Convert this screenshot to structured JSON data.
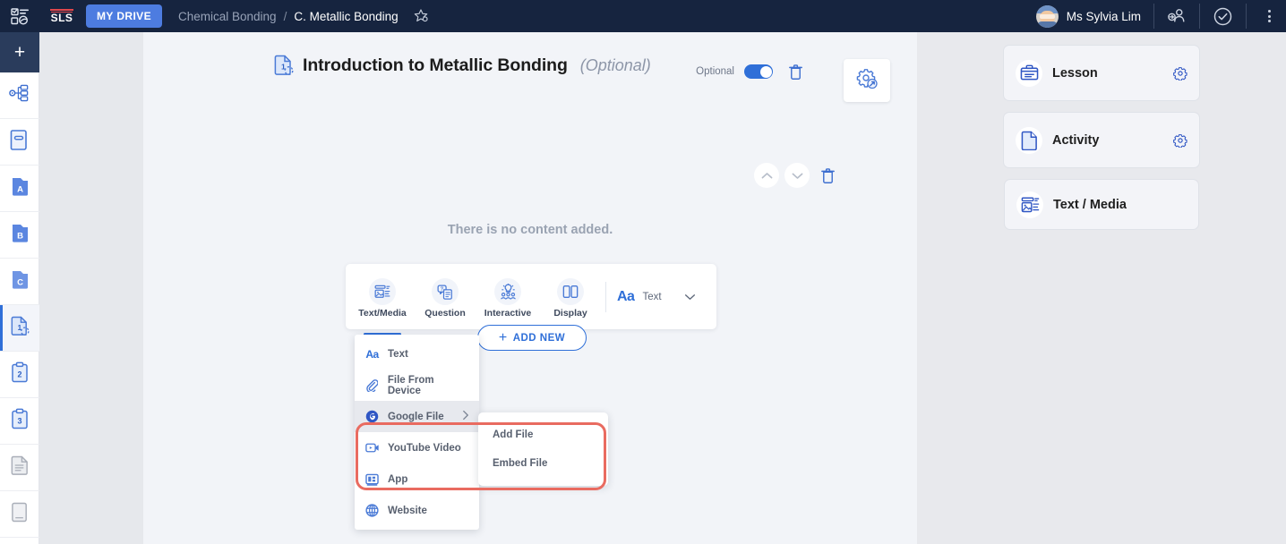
{
  "topbar": {
    "apps_icon": "apps-grid-icon",
    "logo": "SLS",
    "my_drive_label": "MY DRIVE",
    "breadcrumb_parent": "Chemical Bonding",
    "breadcrumb_separator": "/",
    "breadcrumb_current": "C. Metallic Bonding",
    "breadcrumb_icon": "favourite-star-icon",
    "user_name": "Ms Sylvia Lim",
    "share_icon": "share-user-icon",
    "check_icon": "check-circle-icon",
    "more_icon": "kebab-menu-icon"
  },
  "rail": {
    "add_label": "+",
    "items": [
      {
        "name": "sidebar-item-structure",
        "icon": "sitemap-icon",
        "active": false
      },
      {
        "name": "sidebar-item-book",
        "icon": "book-icon",
        "active": false
      },
      {
        "name": "sidebar-item-section-a",
        "icon": "folder-a-icon",
        "label": "A",
        "active": false
      },
      {
        "name": "sidebar-item-section-b",
        "icon": "folder-b-icon",
        "label": "B",
        "active": false
      },
      {
        "name": "sidebar-item-section-c",
        "icon": "folder-c-icon",
        "label": "C",
        "active": false
      },
      {
        "name": "sidebar-item-page-1",
        "icon": "page-1-icon",
        "label": "1",
        "active": true
      },
      {
        "name": "sidebar-item-page-2",
        "icon": "clipboard-2-icon",
        "label": "2",
        "active": false
      },
      {
        "name": "sidebar-item-page-3",
        "icon": "clipboard-3-icon",
        "label": "3",
        "active": false
      },
      {
        "name": "sidebar-item-document",
        "icon": "document-icon",
        "active": false
      },
      {
        "name": "sidebar-item-blank-page",
        "icon": "blank-page-icon",
        "active": false
      }
    ]
  },
  "main": {
    "title": "Introduction to Metallic Bonding",
    "title_suffix": "(Optional)",
    "title_icon": "page-1-icon",
    "optional_toggle_label": "Optional",
    "optional_toggle_on": true,
    "delete_icon": "trash-icon",
    "settings_card_icon": "gear-collapse-icon",
    "move_up_icon": "chevron-up-icon",
    "move_down_icon": "chevron-down-icon",
    "block_delete_icon": "trash-icon",
    "empty_message": "There is no content added.",
    "toolbar": {
      "tabs": [
        {
          "label": "Text/Media",
          "icon": "text-media-icon",
          "active": true
        },
        {
          "label": "Question",
          "icon": "question-icon",
          "active": false
        },
        {
          "label": "Interactive",
          "icon": "interactive-icon",
          "active": false
        },
        {
          "label": "Display",
          "icon": "display-columns-icon",
          "active": false
        }
      ],
      "select_prefix": "Aa",
      "select_value": "Text",
      "select_chevron": "chevron-down-icon"
    },
    "add_new_label": "ADD NEW",
    "add_new_icon": "plus-icon",
    "dropdown": {
      "items": [
        {
          "label": "Text",
          "icon": "aa-text-icon",
          "selected": false,
          "has_submenu": false
        },
        {
          "label": "File From Device",
          "icon": "paperclip-icon",
          "selected": false,
          "has_submenu": false
        },
        {
          "label": "Google File",
          "icon": "google-icon",
          "selected": true,
          "has_submenu": true
        },
        {
          "label": "YouTube Video",
          "icon": "youtube-icon",
          "selected": false,
          "has_submenu": false
        },
        {
          "label": "App",
          "icon": "app-grid-icon",
          "selected": false,
          "has_submenu": false
        },
        {
          "label": "Website",
          "icon": "globe-icon",
          "selected": false,
          "has_submenu": false
        }
      ],
      "submenu_arrow": "chevron-right-icon",
      "submenu": [
        {
          "label": "Add File"
        },
        {
          "label": "Embed File"
        }
      ]
    }
  },
  "right_sidebar": {
    "panels": [
      {
        "label": "Lesson",
        "icon": "lesson-clipboard-icon",
        "gear": true
      },
      {
        "label": "Activity",
        "icon": "activity-document-icon",
        "gear": true
      },
      {
        "label": "Text / Media",
        "icon": "text-media-icon",
        "gear": false
      }
    ],
    "gear_icon": "gear-icon"
  },
  "colors": {
    "topbar_bg": "#16243f",
    "accent_blue": "#2f6fd8",
    "mydrive_blue": "#4d7ce0",
    "logo_red": "#e0474c",
    "highlight_red": "#e96b60",
    "main_bg": "#f2f4f8",
    "page_bg": "#e8e9ed"
  }
}
